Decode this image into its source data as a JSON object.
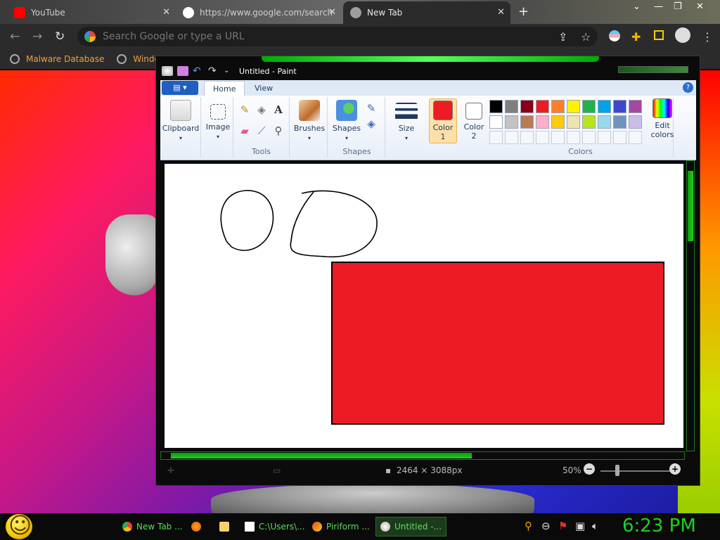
{
  "browser": {
    "tabs": [
      {
        "label": "YouTube",
        "favicon_color": "#ff0000"
      },
      {
        "label": "https://www.google.com/search",
        "favicon_color": "#ffffff"
      },
      {
        "label": "New Tab",
        "favicon_color": "#9e9e9e"
      }
    ],
    "address_placeholder": "Search Google or type a URL",
    "bookmarks": [
      "Malware Database",
      "Windows"
    ]
  },
  "paint": {
    "title": "Untitled - Paint",
    "tabs": [
      "Home",
      "View"
    ],
    "groups": {
      "clipboard": "Clipboard",
      "image": "Image",
      "tools": "Tools",
      "brushes": "Brushes",
      "shapes_btn": "Shapes",
      "shapes": "Shapes",
      "size": "Size",
      "color1": "Color",
      "color1_num": "1",
      "color2": "Color",
      "color2_num": "2",
      "colors": "Colors",
      "edit_colors_1": "Edit",
      "edit_colors_2": "colors"
    },
    "help_label": "?",
    "color1_value": "#ed1c24",
    "color2_value": "#ffffff",
    "palette_row1": [
      "#000000",
      "#7f7f7f",
      "#880015",
      "#ed1c24",
      "#ff7f27",
      "#fff200",
      "#22b14c",
      "#00a2e8",
      "#3f48cc",
      "#a349a4"
    ],
    "palette_row2": [
      "#ffffff",
      "#c3c3c3",
      "#b97a57",
      "#ffaec9",
      "#ffc90e",
      "#efe4b0",
      "#b5e61d",
      "#99d9ea",
      "#7092be",
      "#c8bfe7"
    ],
    "status": {
      "dimensions": "2464 × 3088px",
      "zoom": "50%"
    }
  },
  "taskbar": {
    "items": [
      "New Tab ...",
      "C:\\Users\\...",
      "Piriform ...",
      "Untitled -..."
    ],
    "clock": "6:23 PM"
  }
}
